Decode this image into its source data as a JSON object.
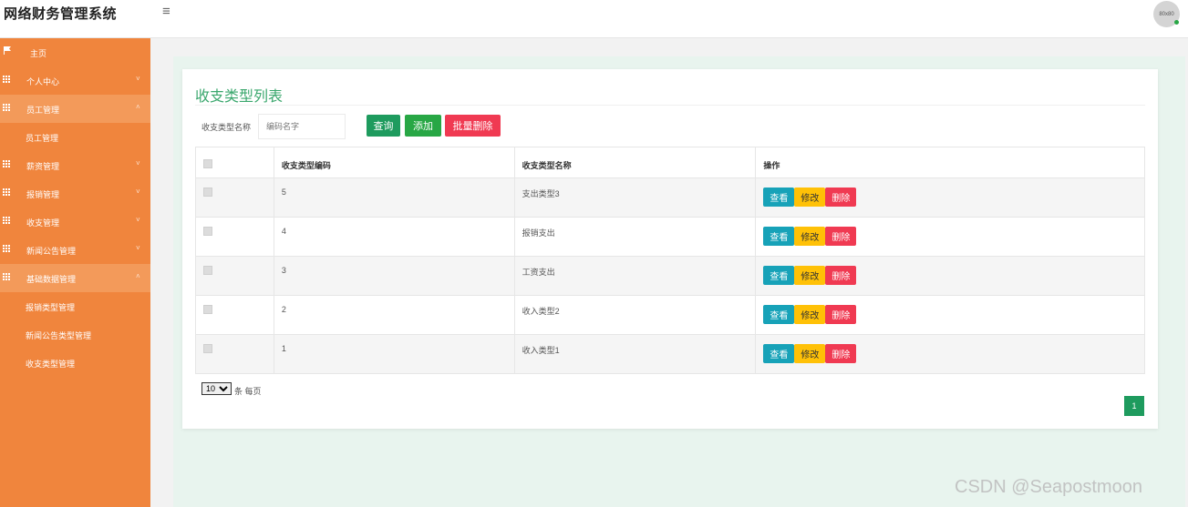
{
  "app": {
    "title": "网络财务管理系统",
    "menu_icon": "hamburger-icon",
    "avatar_text": "80x80"
  },
  "sidebar": {
    "home": "主页",
    "items": [
      {
        "label": "个人中心",
        "expanded": false
      },
      {
        "label": "员工管理",
        "expanded": true
      },
      {
        "label": "薪资管理",
        "expanded": false
      },
      {
        "label": "报销管理",
        "expanded": false
      },
      {
        "label": "收支管理",
        "expanded": false
      },
      {
        "label": "新闻公告管理",
        "expanded": false
      },
      {
        "label": "基础数据管理",
        "expanded": true
      }
    ],
    "sub_employee": [
      "员工管理"
    ],
    "sub_basic": [
      "报销类型管理",
      "新闻公告类型管理",
      "收支类型管理"
    ],
    "arrow_down": "˅",
    "arrow_up": "˄"
  },
  "page": {
    "title": "收支类型列表",
    "search_label": "收支类型名称",
    "search_placeholder": "编码名字",
    "query_label": "查询",
    "add_label": "添加",
    "bulk_delete_label": "批量删除"
  },
  "table": {
    "headers": [
      "收支类型编码",
      "收支类型名称",
      "操作"
    ],
    "rows": [
      {
        "code": "5",
        "name": "支出类型3"
      },
      {
        "code": "4",
        "name": "报销支出"
      },
      {
        "code": "3",
        "name": "工资支出"
      },
      {
        "code": "2",
        "name": "收入类型2"
      },
      {
        "code": "1",
        "name": "收入类型1"
      }
    ],
    "view_label": "查看",
    "edit_label": "修改",
    "delete_label": "删除"
  },
  "pager": {
    "page_size": "10",
    "page_size_label": "条 每页",
    "current_page": "1"
  },
  "watermark": "CSDN @Seapostmoon",
  "colors": {
    "sidebar": "#f0853d",
    "accent": "#3aa76d",
    "danger": "#f03a52",
    "info": "#17a2b8",
    "warning": "#ffc107"
  }
}
